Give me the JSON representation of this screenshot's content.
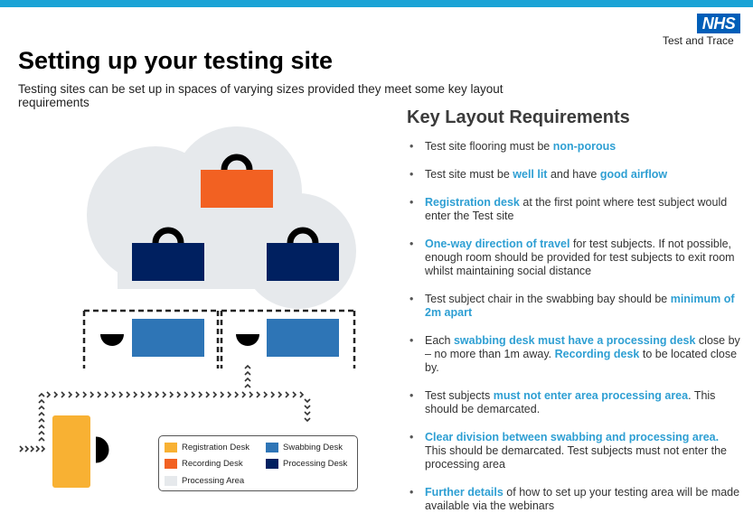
{
  "brand": {
    "logo": "NHS",
    "subtitle": "Test and Trace"
  },
  "page": {
    "title": "Setting up your testing site",
    "intro": "Testing sites can be set up in spaces of varying sizes provided they meet some key layout requirements"
  },
  "requirements": {
    "heading": "Key Layout Requirements",
    "items": [
      [
        {
          "t": "Test site flooring must be "
        },
        {
          "t": "non-porous",
          "h": true
        }
      ],
      [
        {
          "t": "Test site must be "
        },
        {
          "t": "well lit",
          "h": true
        },
        {
          "t": " and have "
        },
        {
          "t": "good airflow",
          "h": true
        }
      ],
      [
        {
          "t": "Registration desk",
          "h": true
        },
        {
          "t": " at the first point where test subject would enter the Test site"
        }
      ],
      [
        {
          "t": "One-way direction of travel",
          "h": true
        },
        {
          "t": " for test subjects. If not possible, enough room should be provided for test subjects to exit room whilst maintaining social distance"
        }
      ],
      [
        {
          "t": "Test subject chair in the swabbing bay should be "
        },
        {
          "t": "minimum of 2m apart",
          "h": true
        }
      ],
      [
        {
          "t": "Each "
        },
        {
          "t": "swabbing desk must have a processing desk",
          "h": true
        },
        {
          "t": " close by – no more than 1m away. "
        },
        {
          "t": "Recording desk",
          "h": true
        },
        {
          "t": " to be located close by."
        }
      ],
      [
        {
          "t": "Test subjects "
        },
        {
          "t": "must not enter area processing area",
          "h": true
        },
        {
          "t": ". This should be demarcated."
        }
      ],
      [
        {
          "t": "Clear division between swabbing and processing area.",
          "h": true
        },
        {
          "t": " This should be demarcated. Test subjects must not enter the processing area"
        }
      ],
      [
        {
          "t": "Further details",
          "h": true
        },
        {
          "t": " of how to set up your testing area will be made available via the webinars"
        }
      ]
    ]
  },
  "legend": {
    "registration": "Registration Desk",
    "swabbing": "Swabbing Desk",
    "recording": "Recording Desk",
    "processing_desk": "Processing Desk",
    "processing_area": "Processing Area"
  },
  "colors": {
    "header_bar": "#1aa3d6",
    "nhs_blue": "#005eb8",
    "highlight": "#2e9fd3",
    "registration_desk": "#f8b133",
    "recording_desk": "#f26122",
    "swabbing_desk": "#2e75b6",
    "processing_desk": "#002060",
    "processing_area": "#e6e9ec"
  }
}
